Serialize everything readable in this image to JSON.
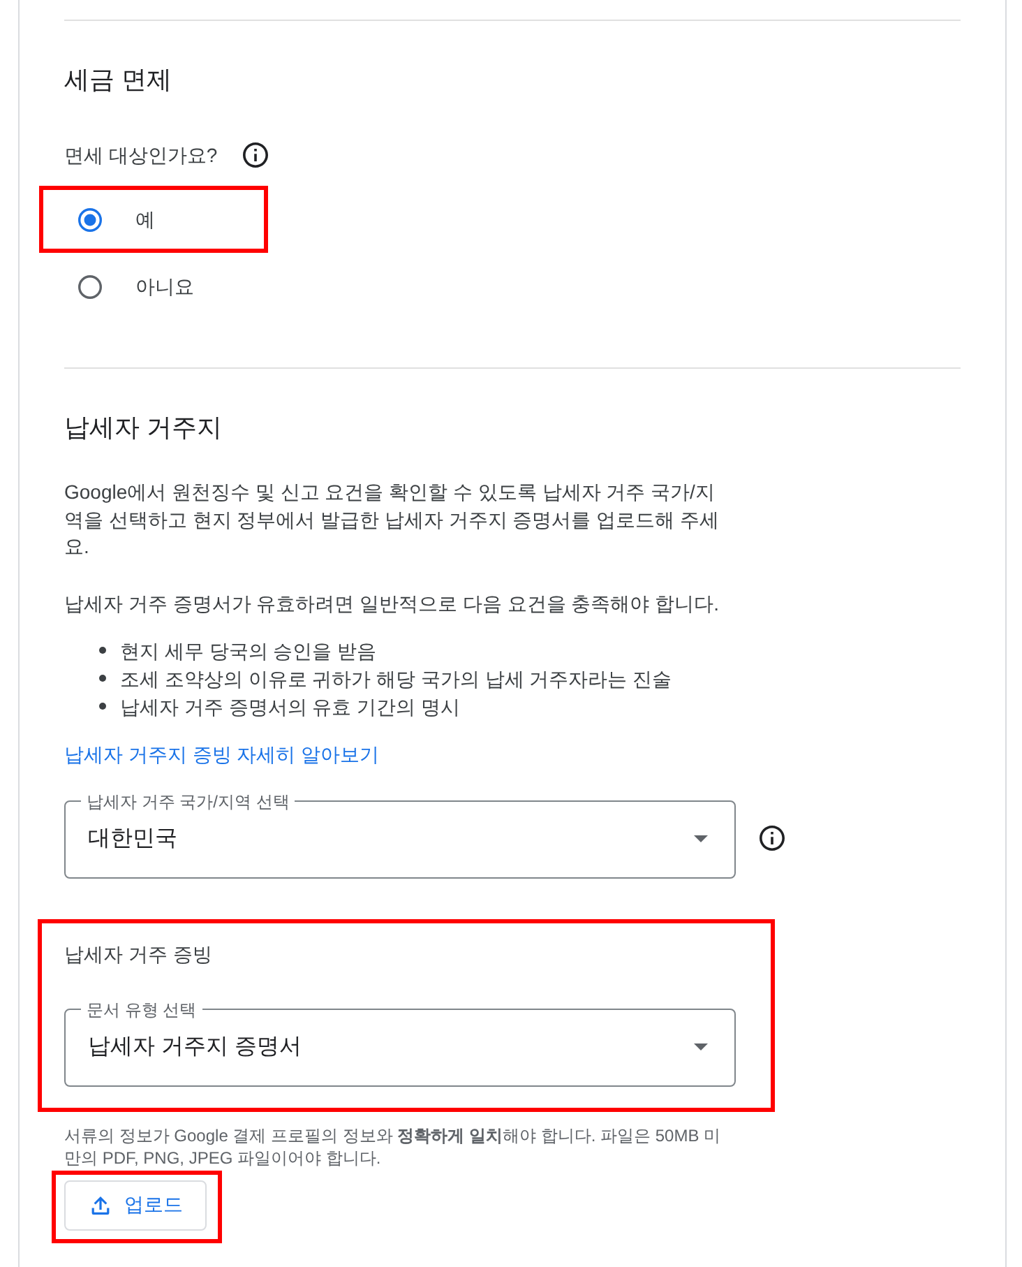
{
  "tax_exemption": {
    "title": "세금 면제",
    "question": "면세 대상인가요?",
    "options": [
      {
        "label": "예",
        "selected": true,
        "highlighted": true
      },
      {
        "label": "아니요",
        "selected": false,
        "highlighted": false
      }
    ]
  },
  "taxpayer_residence": {
    "title": "납세자 거주지",
    "description": "Google에서 원천징수 및 신고 요건을 확인할 수 있도록 납세자 거주 국가/지역을 선택하고 현지 정부에서 발급한 납세자 거주지 증명서를 업로드해 주세요.",
    "requirements_intro": "납세자 거주 증명서가 유효하려면 일반적으로 다음 요건을 충족해야 합니다.",
    "requirements": [
      "현지 세무 당국의 승인을 받음",
      "조세 조약상의 이유로 귀하가 해당 국가의 납세 거주자라는 진술",
      "납세자 거주 증명서의 유효 기간의 명시"
    ],
    "learn_more_link": "납세자 거주지 증빙 자세히 알아보기",
    "country_select": {
      "label": "납세자 거주 국가/지역 선택",
      "value": "대한민국"
    }
  },
  "residence_proof": {
    "title": "납세자 거주 증빙",
    "highlighted": true,
    "document_type_select": {
      "label": "문서 유형 선택",
      "value": "납세자 거주지 증명서"
    },
    "note": "서류의 정보가 Google 결제 프로필의 정보와 **정확하게 일치**해야 합니다. 파일은 50MB 미만의 PDF, PNG, JPEG 파일이어야 합니다.",
    "upload_button": {
      "label": "업로드",
      "highlighted": true
    }
  }
}
